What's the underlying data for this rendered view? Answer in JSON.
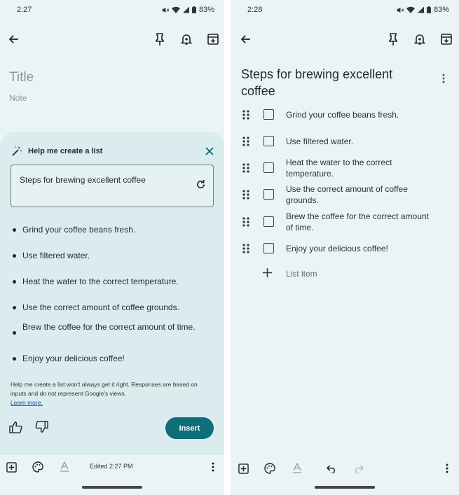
{
  "left": {
    "status": {
      "time": "2:27",
      "battery": "83%"
    },
    "editor": {
      "title_placeholder": "Title",
      "note_placeholder": "Note"
    },
    "assist": {
      "heading": "Help me create a list",
      "prompt": "Steps for brewing excellent coffee",
      "suggestions": [
        "Grind your coffee beans fresh.",
        "Use filtered water.",
        "Heat the water to the correct temperature.",
        "Use the correct amount of coffee grounds.",
        "Brew the coffee for the correct amount of time.",
        "Enjoy your delicious coffee!"
      ],
      "disclaimer": "Help me create a list won't always get it right. Responses are based on inputs and do not represent Google's views.",
      "learn_more": "Learn more.",
      "insert_label": "Insert"
    },
    "bottom": {
      "edited": "Edited 2:27 PM"
    }
  },
  "right": {
    "status": {
      "time": "2:28",
      "battery": "83%"
    },
    "note_title": "Steps for brewing excellent coffee",
    "items": [
      "Grind your coffee beans fresh.",
      "Use filtered water.",
      "Heat the water to the correct temperature.",
      "Use the correct amount of coffee grounds.",
      "Brew the coffee for the correct amount of time.",
      "Enjoy your delicious coffee!"
    ],
    "add_item_label": "List item"
  },
  "colors": {
    "background": "#eaf4f6",
    "sheet": "#dbecef",
    "accent": "#0e6e79",
    "link": "#0b57a5"
  },
  "icons": [
    "back-arrow-icon",
    "pin-icon",
    "reminder-bell-icon",
    "archive-icon",
    "sparkle-pen-icon",
    "close-icon",
    "refresh-icon",
    "thumbs-up-icon",
    "thumbs-down-icon",
    "add-box-icon",
    "palette-icon",
    "text-format-icon",
    "more-vert-icon",
    "drag-handle-icon",
    "checkbox-icon",
    "plus-icon",
    "undo-icon",
    "redo-icon"
  ]
}
